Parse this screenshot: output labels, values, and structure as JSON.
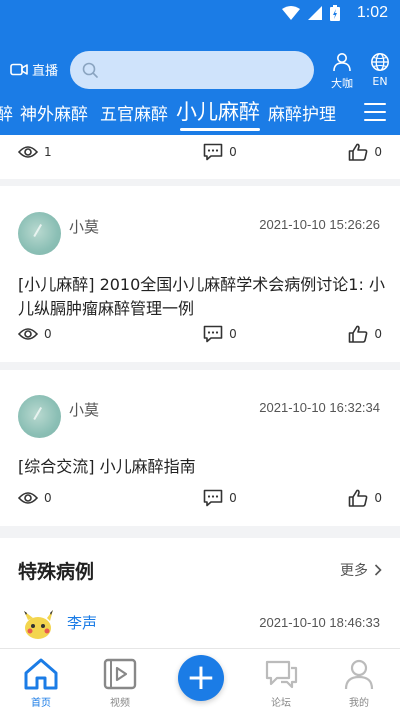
{
  "status_bar": {
    "time": "1:02"
  },
  "header": {
    "live_label": "直播",
    "search_placeholder": "",
    "expert_label": "大咖",
    "lang_label": "EN"
  },
  "tabs": [
    {
      "label": "醉"
    },
    {
      "label": "神外麻醉"
    },
    {
      "label": "五官麻醉"
    },
    {
      "label": "小儿麻醉"
    },
    {
      "label": "麻醉护理"
    }
  ],
  "posts": [
    {
      "views": "1",
      "comments": "0",
      "likes": "0"
    },
    {
      "author": "小莫",
      "time": "2021-10-10 15:26:26",
      "title": "[小儿麻醉] 2010全国小儿麻醉学术会病例讨论1: 小儿纵膈肿瘤麻醉管理一例",
      "views": "0",
      "comments": "0",
      "likes": "0"
    },
    {
      "author": "小莫",
      "time": "2021-10-10 16:32:34",
      "title": "[综合交流] 小儿麻醉指南",
      "views": "0",
      "comments": "0",
      "likes": "0"
    }
  ],
  "special_cases": {
    "title": "特殊病例",
    "more_label": "更多",
    "first_item": {
      "author": "李声",
      "time": "2021-10-10 18:46:33"
    }
  },
  "bottom_nav": {
    "home": "首页",
    "video": "视频",
    "forum": "论坛",
    "mine": "我的"
  },
  "colors": {
    "brand": "#1b7ce6"
  }
}
